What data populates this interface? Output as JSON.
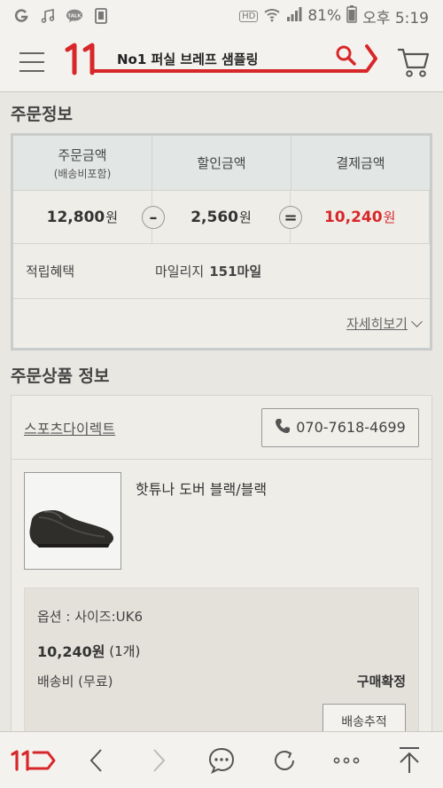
{
  "status_bar": {
    "battery": "81%",
    "time": "오후 5:19",
    "hd_label": "HD",
    "icons": [
      "g-icon",
      "music-icon",
      "talk-icon",
      "sim-icon",
      "wifi-icon",
      "signal-icon",
      "battery-icon"
    ]
  },
  "header": {
    "logo_text": "11",
    "search_text": "No1 퍼실 브레프 샘플링",
    "icons": [
      "hamburger-menu-icon",
      "search-icon",
      "cart-icon"
    ]
  },
  "order_info": {
    "title": "주문정보",
    "col1_label": "주문금액",
    "col1_sub": "(배송비포함)",
    "col2_label": "할인금액",
    "col3_label": "결제금액",
    "order_amount": "12,800",
    "discount_amount": "2,560",
    "pay_amount": "10,240",
    "currency": "원",
    "minus": "–",
    "equals": "=",
    "reward_label": "적립혜택",
    "reward_prefix": "마일리지",
    "reward_value": "151마일",
    "detail_link": "자세히보기"
  },
  "product_info": {
    "title": "주문상품 정보",
    "seller": "스포츠다이렉트",
    "phone": "070-7618-4699",
    "item_name": "핫튜나 도버 블랙/블랙",
    "option": "옵션 : 사이즈:UK6",
    "price": "10,240원",
    "quantity": "(1개)",
    "shipping": "배송비 (무료)",
    "status": "구매확정",
    "track_button": "배송추적"
  },
  "bottom_nav": {
    "logo_text": "11",
    "icons": [
      "11st-home-icon",
      "back-icon",
      "forward-icon",
      "chat-icon",
      "refresh-icon",
      "more-icon",
      "scroll-top-icon"
    ]
  },
  "colors": {
    "brand_red": "#d8272a",
    "background": "#e9e7e2"
  }
}
